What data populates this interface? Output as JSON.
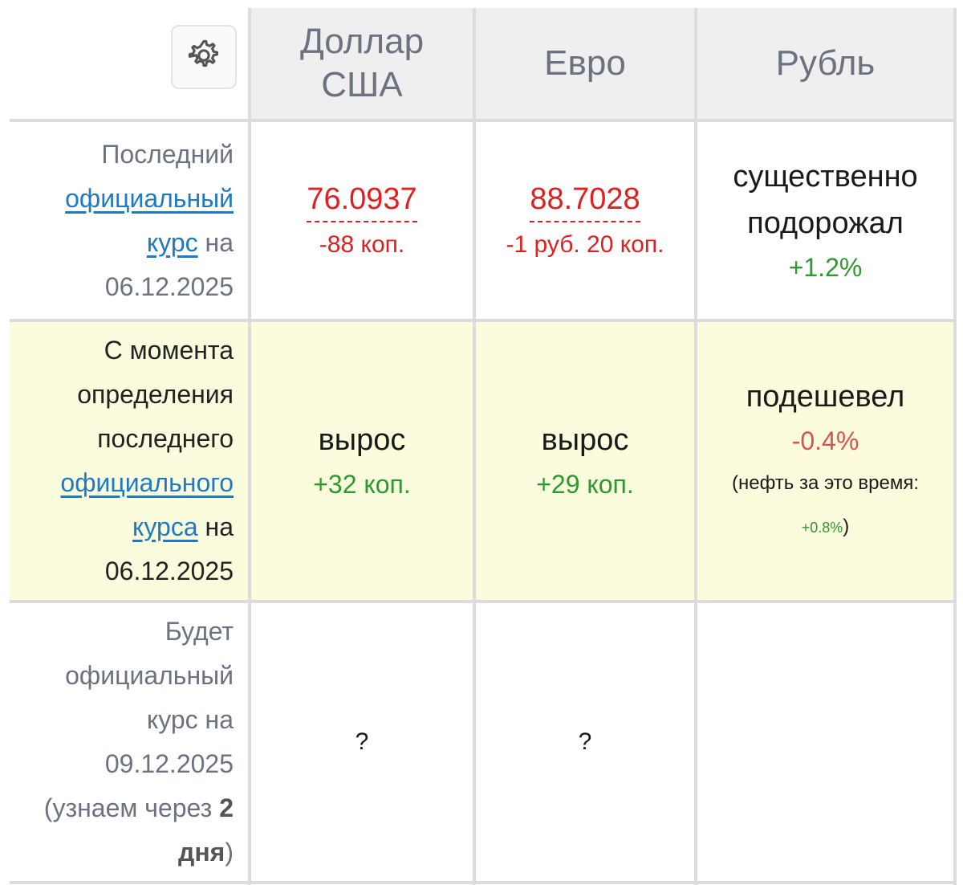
{
  "header": {
    "settings_icon": "gear-icon",
    "columns": [
      {
        "line1": "Доллар",
        "line2": "США"
      },
      {
        "label": "Евро"
      },
      {
        "label": "Рубль"
      }
    ]
  },
  "row_official": {
    "label_line1": "Последний",
    "label_link": "официальный",
    "label_link2": "курс",
    "label_after": " на",
    "label_date": "06.12.2025",
    "usd": {
      "rate": "76.0937",
      "delta": "-88 коп."
    },
    "eur": {
      "rate": "88.7028",
      "delta": "-1 руб. 20 коп."
    },
    "rub": {
      "line1": "существенно",
      "line2": "подорожал",
      "change": "+1.2%"
    }
  },
  "row_since": {
    "label_line1": "С момента",
    "label_line2": "определения",
    "label_line3": "последнего",
    "label_link": "официального",
    "label_link2": "курса",
    "label_after": " на",
    "label_date": "06.12.2025",
    "usd": {
      "status": "вырос",
      "change": "+32 коп."
    },
    "eur": {
      "status": "вырос",
      "change": "+29 коп."
    },
    "rub": {
      "status": "подешевел",
      "change": "-0.4%",
      "oil_prefix": "(нефть за это время:",
      "oil_change": "+0.8%",
      "oil_suffix": ")"
    }
  },
  "row_future": {
    "label_line1": "Будет",
    "label_line2": "официальный",
    "label_line3": "курс на",
    "label_date": "09.12.2025",
    "label_wait_prefix": "(узнаем через ",
    "label_wait_num": "2",
    "label_wait_unit": "дня",
    "label_wait_suffix": ")",
    "usd": "?",
    "eur": "?"
  },
  "colors": {
    "header_bg": "#efefef",
    "highlight_row_bg": "#fbfbdd",
    "negative": "#e02020",
    "positive": "#2e9a2e",
    "link": "#1f7ac4"
  }
}
